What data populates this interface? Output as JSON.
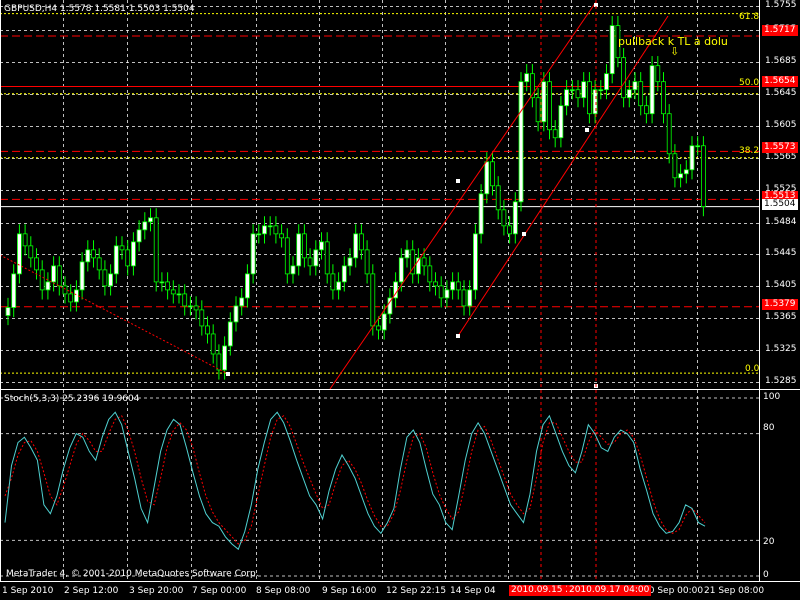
{
  "header": {
    "symbol_line": "GBPUSD,H4  1.5578 1.5581 1.5503 1.5504",
    "indicator_line": "Stoch(5,3,3) 25.2396 19.9604"
  },
  "copyright": "MetaTrader 4, © 2001-2010 MetaQuotes Software Corp.",
  "annotation": "pullback k TL a dolu",
  "colors": {
    "background": "#000000",
    "bull_candle": "#ffffff",
    "bear_candle": "#000000",
    "candle_wick": "#00ff00",
    "grid": "#ffffff",
    "red_line": "#ff0000",
    "fib_line": "#ffff00",
    "stoch_main": "#4fd0d0",
    "stoch_signal": "#ff0000"
  },
  "chart_data": [
    {
      "type": "candlestick",
      "title": "GBPUSD,H4",
      "ylim": [
        1.5275,
        1.5762
      ],
      "yticks": [
        "1.5755",
        "1.5725",
        "1.5685",
        "1.5645",
        "1.5605",
        "1.5565",
        "1.5525",
        "1.5484",
        "1.5445",
        "1.5405",
        "1.5365",
        "1.5325",
        "1.5285"
      ],
      "xticks": [
        "1 Sep 2010",
        "2 Sep 12:00",
        "3 Sep 20:00",
        "7 Sep 00:00",
        "8 Sep 08:00",
        "9 Sep 16:00",
        "12 Sep 22:15",
        "14 Sep 04",
        "20 Sep 00:00",
        "21 Sep 08:00"
      ],
      "xtick_highlight": [
        "2010.09.15 20",
        "2010.09.17 04:00"
      ],
      "closes": [
        1.5378,
        1.542,
        1.547,
        1.5455,
        1.544,
        1.5425,
        1.54,
        1.541,
        1.543,
        1.5405,
        1.5395,
        1.5385,
        1.54,
        1.5435,
        1.545,
        1.544,
        1.5425,
        1.5405,
        1.542,
        1.5455,
        1.545,
        1.543,
        1.546,
        1.5475,
        1.5485,
        1.549,
        1.541,
        1.541,
        1.54,
        1.5395,
        1.5395,
        1.538,
        1.538,
        1.5375,
        1.5355,
        1.5345,
        1.532,
        1.53,
        1.533,
        1.536,
        1.538,
        1.539,
        1.542,
        1.547,
        1.547,
        1.548,
        1.548,
        1.547,
        1.5465,
        1.542,
        1.543,
        1.547,
        1.544,
        1.543,
        1.545,
        1.546,
        1.542,
        1.54,
        1.541,
        1.543,
        1.544,
        1.547,
        1.545,
        1.542,
        1.5355,
        1.535,
        1.537,
        1.539,
        1.541,
        1.544,
        1.545,
        1.542,
        1.544,
        1.543,
        1.541,
        1.5405,
        1.539,
        1.54,
        1.541,
        1.54,
        1.538,
        1.54,
        1.547,
        1.552,
        1.556,
        1.553,
        1.55,
        1.548,
        1.547,
        1.551,
        1.566,
        1.567,
        1.564,
        1.561,
        1.566,
        1.56,
        1.559,
        1.563,
        1.565,
        1.565,
        1.564,
        1.566,
        1.562,
        1.565,
        1.565,
        1.567,
        1.573,
        1.569,
        1.564,
        1.565,
        1.566,
        1.563,
        1.562,
        1.568,
        1.566,
        1.562,
        1.557,
        1.554,
        1.5545,
        1.555,
        1.558,
        1.558,
        1.5504
      ],
      "stoch_main": [
        30,
        62,
        75,
        78,
        72,
        65,
        40,
        35,
        45,
        60,
        72,
        80,
        78,
        70,
        65,
        78,
        88,
        92,
        85,
        70,
        55,
        38,
        30,
        50,
        70,
        82,
        88,
        85,
        72,
        58,
        45,
        35,
        30,
        28,
        22,
        18,
        15,
        25,
        40,
        60,
        75,
        88,
        92,
        86,
        76,
        65,
        55,
        45,
        40,
        32,
        48,
        60,
        68,
        62,
        55,
        45,
        35,
        28,
        24,
        30,
        38,
        60,
        78,
        82,
        75,
        60,
        46,
        40,
        30,
        26,
        45,
        65,
        80,
        86,
        80,
        70,
        60,
        50,
        40,
        35,
        30,
        46,
        70,
        85,
        90,
        80,
        70,
        62,
        58,
        70,
        85,
        80,
        72,
        70,
        78,
        82,
        80,
        75,
        60,
        48,
        35,
        28,
        24,
        25,
        30,
        40,
        38,
        30,
        28
      ],
      "stoch_signal": [
        45,
        55,
        68,
        75,
        76,
        70,
        58,
        45,
        40,
        50,
        62,
        74,
        80,
        76,
        70,
        70,
        80,
        88,
        90,
        82,
        70,
        55,
        42,
        40,
        55,
        72,
        82,
        86,
        82,
        72,
        58,
        45,
        36,
        30,
        26,
        22,
        18,
        20,
        28,
        45,
        62,
        78,
        88,
        90,
        84,
        74,
        64,
        55,
        46,
        38,
        40,
        52,
        62,
        65,
        60,
        52,
        42,
        34,
        28,
        28,
        35,
        48,
        65,
        78,
        80,
        72,
        58,
        46,
        38,
        32,
        36,
        52,
        70,
        82,
        84,
        76,
        66,
        56,
        46,
        40,
        35,
        38,
        55,
        75,
        86,
        86,
        78,
        70,
        64,
        64,
        75,
        82,
        78,
        74,
        75,
        80,
        82,
        78,
        68,
        55,
        42,
        32,
        26,
        24,
        26,
        34,
        38,
        34,
        30
      ],
      "stoch_levels": [
        "100",
        "80",
        "20",
        "0"
      ]
    }
  ],
  "price_tags": {
    "t1": "1.5717",
    "t2": "1.5654",
    "t3": "1.5573",
    "t4": "1.5513",
    "t5": "1.5504",
    "t6": "1.5379"
  },
  "fib_labels": {
    "f618": "61.8",
    "f500": "50.0",
    "f382": "38.2",
    "f000": "0.0"
  }
}
